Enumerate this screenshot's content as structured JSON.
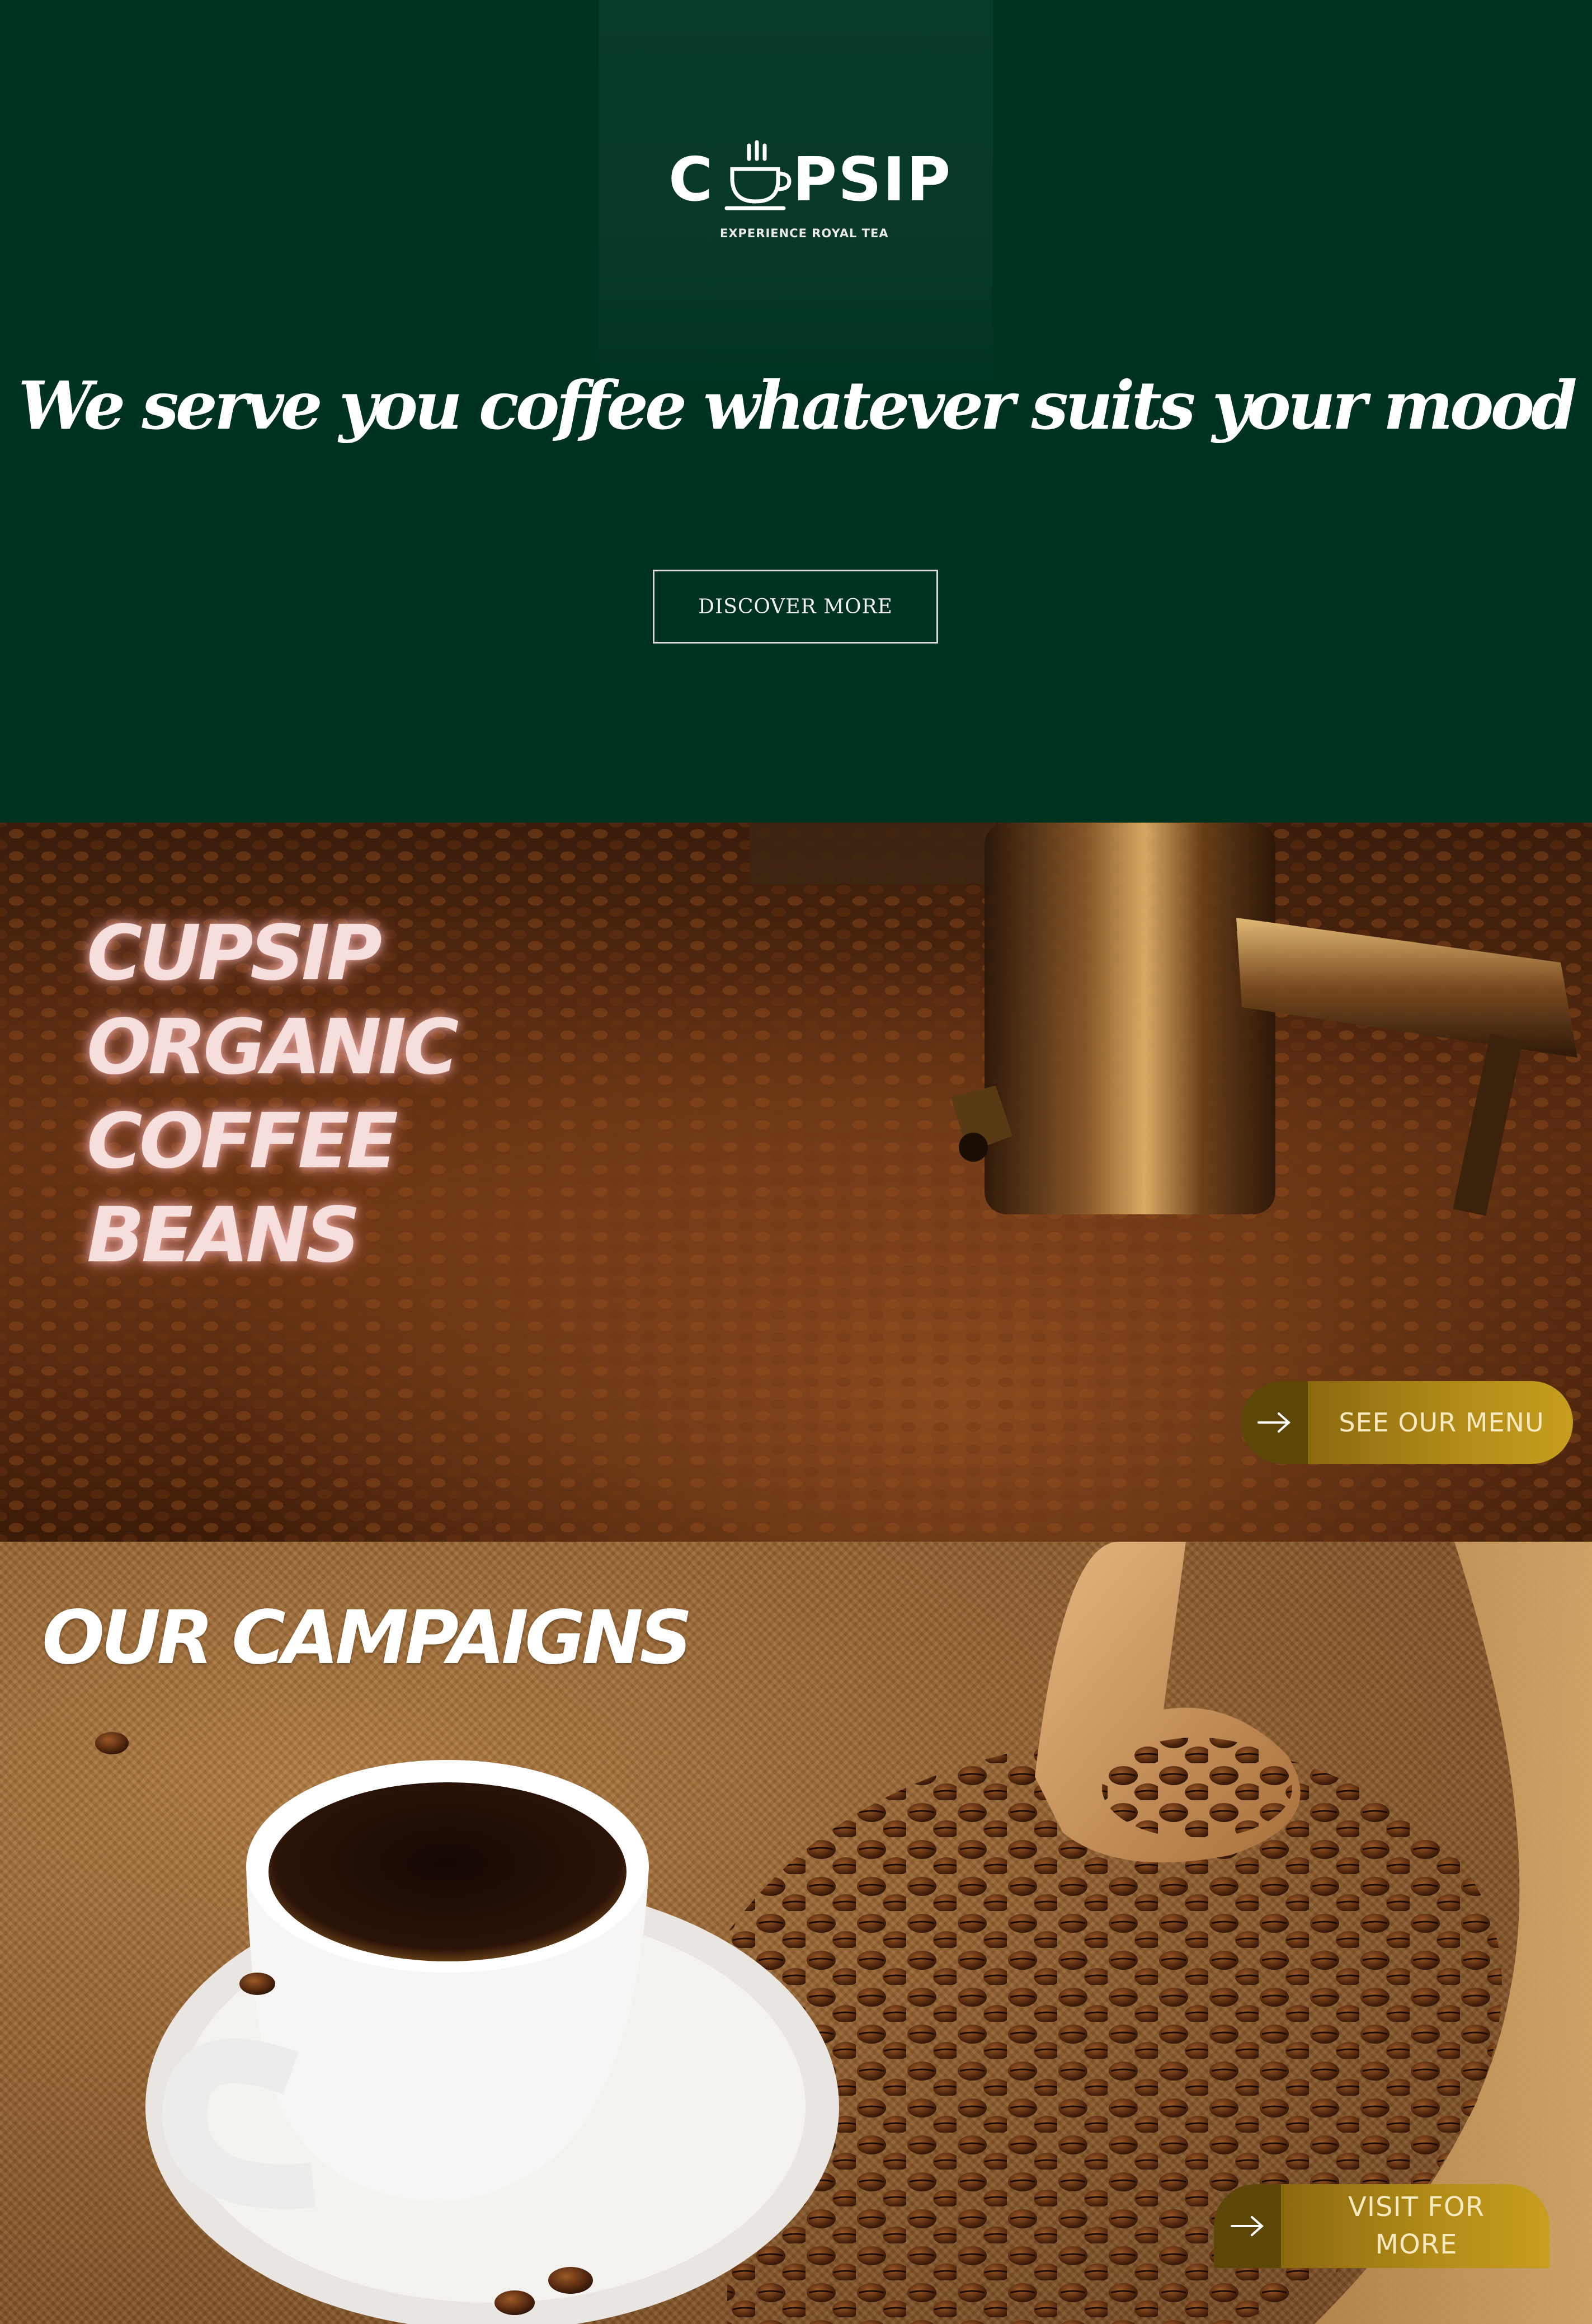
{
  "hero": {
    "logo": {
      "text_left": "C",
      "text_right": "PSIP",
      "tagline": "EXPERIENCE ROYAL TEA",
      "icon": "coffee-cup-icon"
    },
    "headline": "We serve you coffee whatever suits your mood",
    "cta_label": "DISCOVER MORE",
    "background_color": "#00331f"
  },
  "beans_section": {
    "title": "CUPSIP\nORGANIC\nCOFFEE\nBEANS",
    "cta_label": "SEE OUR MENU",
    "cta_icon": "arrow-right-icon"
  },
  "campaigns_section": {
    "title": "OUR CAMPAIGNS",
    "cta_label": "VISIT FOR\nMORE",
    "cta_icon": "arrow-right-icon"
  },
  "colors": {
    "brand_green": "#00331f",
    "gold_accent": "#b48d18",
    "neon_pink": "#f6dedd"
  }
}
